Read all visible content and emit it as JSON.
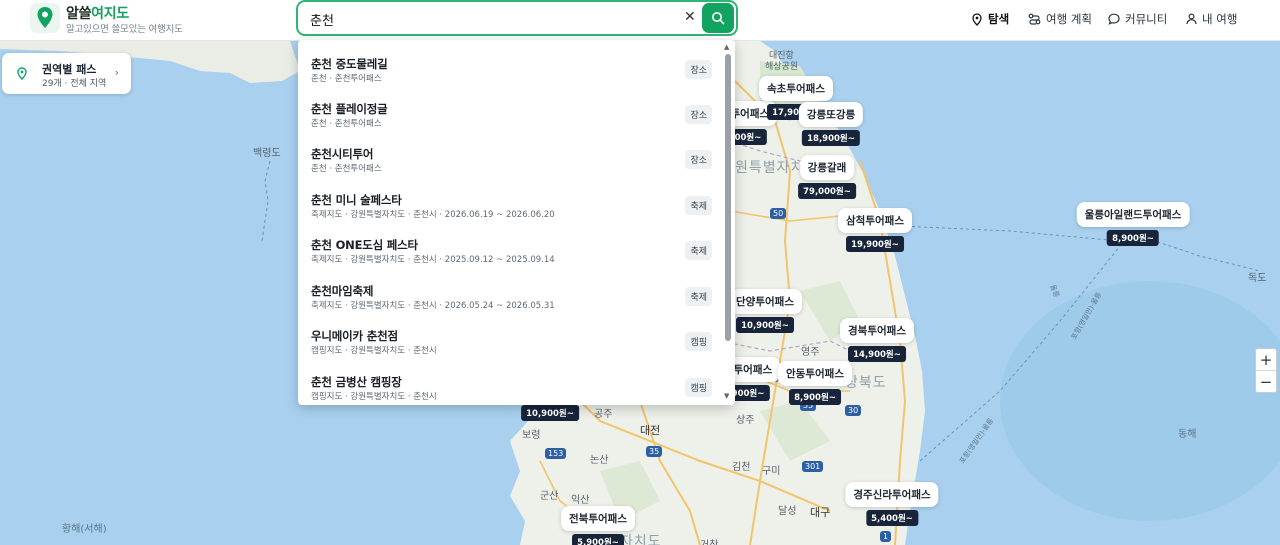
{
  "brand": {
    "name_part1": "알쓸",
    "name_part2": "여지도",
    "tagline": "알고있으면 쓸모있는 여행지도"
  },
  "search": {
    "value": "춘천",
    "placeholder": "",
    "clear_label": "✕"
  },
  "nav": {
    "explore": "탐색",
    "trip_plan": "여행 계획",
    "community": "커뮤니티",
    "my_trip": "내 여행"
  },
  "region_card": {
    "title": "권역별 패스",
    "subtitle": "29개 · 전체 지역"
  },
  "suggestions": [
    {
      "title": "춘천 중도물레길",
      "sub": "춘천 · 춘천투어패스",
      "tag": "장소"
    },
    {
      "title": "춘천 플레이정글",
      "sub": "춘천 · 춘천투어패스",
      "tag": "장소"
    },
    {
      "title": "춘천시티투어",
      "sub": "춘천 · 춘천투어패스",
      "tag": "장소"
    },
    {
      "title": "춘천 미니 술페스타",
      "sub": "축제지도 · 강원특별자치도 · 춘천시 · 2026.06.19 ~ 2026.06.20",
      "tag": "축제"
    },
    {
      "title": "춘천 ONE도심 페스타",
      "sub": "축제지도 · 강원특별자치도 · 춘천시 · 2025.09.12 ~ 2025.09.14",
      "tag": "축제"
    },
    {
      "title": "춘천마임축제",
      "sub": "축제지도 · 강원특별자치도 · 춘천시 · 2026.05.24 ~ 2026.05.31",
      "tag": "축제"
    },
    {
      "title": "우니메이카 춘천점",
      "sub": "캠핑지도 · 강원특별자치도 · 춘천시",
      "tag": "캠핑"
    },
    {
      "title": "춘천 금병산 캠핑장",
      "sub": "캠핑지도 · 강원특별자치도 · 춘천시",
      "tag": "캠핑"
    }
  ],
  "markers": [
    {
      "name": "속초투어패스",
      "price": "17,900원~"
    },
    {
      "name": "강릉또강릉",
      "price": "18,900원~"
    },
    {
      "name": "강릉갈래",
      "price": "79,000원~"
    },
    {
      "name": "삼척투어패스",
      "price": "19,900원~"
    },
    {
      "name": "울릉아일랜드투어패스",
      "price": "8,900원~"
    },
    {
      "name": "단양투어패스",
      "price": "10,900원~"
    },
    {
      "name": "경북투어패스",
      "price": "14,900원~"
    },
    {
      "name": "안동투어패스",
      "price": "8,900원~"
    },
    {
      "name": "경주신라투어패스",
      "price": "5,400원~"
    },
    {
      "name": "전북투어패스",
      "price": "5,900원~"
    }
  ],
  "partial_markers": {
    "left1": {
      "name": "시투어패스",
      "price": "900원~"
    },
    "left2": {
      "name": "류투어패스",
      "price": "900원~"
    },
    "left3": {
      "price": "10,900원~"
    }
  },
  "places": {
    "baengnyeongdo": "백령도",
    "daejinhang": "대진항",
    "haesanggongwon": "해상공원",
    "gangwon_partial": "원특별자치도",
    "dokdo": "독도",
    "yeongju": "영주",
    "gyeongbuk_partial": "상북도",
    "ye": "예",
    "gongju": "공주",
    "boryeong": "보령",
    "daejeon": "대전",
    "sangju": "상주",
    "nonsan": "논산",
    "gimcheon": "김천",
    "gumi": "구미",
    "gunsan": "군산",
    "iksan": "익산",
    "yeong": "영",
    "dalseong": "달성",
    "daegu": "대구",
    "geochang": "거창",
    "jeonbuk_partial": "자치도",
    "yellow_sea": "황해(서해)",
    "east_sea": "동해",
    "ulleung_route": "포항(영일만)-울릉",
    "ulleung_route2": "포항(영일만)-울릉",
    "hwy": "울릉"
  },
  "routes": [
    "50",
    "55",
    "30",
    "153",
    "35",
    "301",
    "1"
  ],
  "zoom": {
    "in": "+",
    "out": "−"
  },
  "colors": {
    "accent": "#12a361",
    "sea": "#a7d0ee",
    "land": "#eef0ea",
    "marker_price_bg": "#17243a"
  },
  "icons": [
    "pin-icon",
    "search-icon",
    "route-icon",
    "chat-icon",
    "user-icon",
    "chevron-right-icon"
  ]
}
